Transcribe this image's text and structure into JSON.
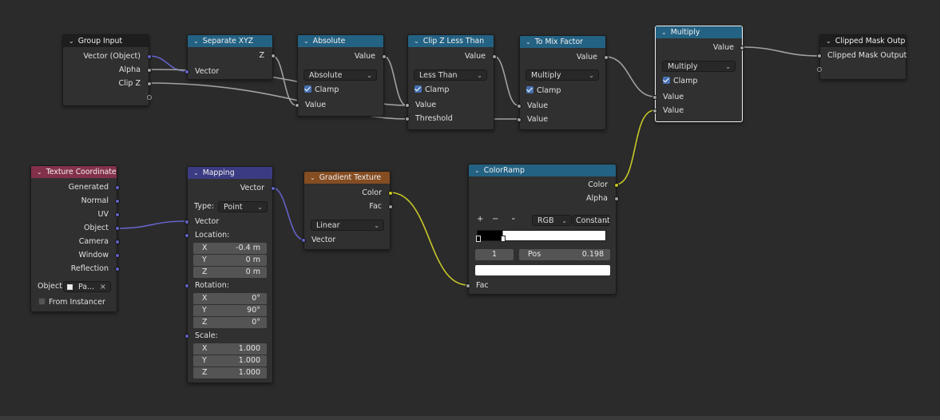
{
  "nodes": {
    "group_input": {
      "title": "Group Input",
      "outputs": [
        "Vector (Object)",
        "Alpha",
        "Clip Z"
      ]
    },
    "separate_xyz": {
      "title": "Separate XYZ",
      "output": "Z",
      "input": "Vector"
    },
    "absolute": {
      "title": "Absolute",
      "output": "Value",
      "operation": "Absolute",
      "clamp_label": "Clamp",
      "clamp": true,
      "input": "Value"
    },
    "clip_z": {
      "title": "Clip Z Less Than",
      "output": "Value",
      "operation": "Less Than",
      "clamp_label": "Clamp",
      "clamp": true,
      "inputs": [
        "Value",
        "Threshold"
      ]
    },
    "to_mix": {
      "title": "To Mix Factor",
      "output": "Value",
      "operation": "Multiply",
      "clamp_label": "Clamp",
      "clamp": true,
      "inputs": [
        "Value",
        "Value"
      ]
    },
    "multiply": {
      "title": "Multiply",
      "output": "Value",
      "operation": "Multiply",
      "clamp_label": "Clamp",
      "clamp": true,
      "inputs": [
        "Value",
        "Value"
      ]
    },
    "clipped_output": {
      "title": "Clipped Mask Output",
      "input": "Clipped Mask Output"
    },
    "texture_coordinate": {
      "title": "Texture Coordinate",
      "outputs": [
        "Generated",
        "Normal",
        "UV",
        "Object",
        "Camera",
        "Window",
        "Reflection"
      ],
      "object_label": "Object:",
      "object_value": "Pa...",
      "from_instancer_label": "From Instancer"
    },
    "mapping": {
      "title": "Mapping",
      "output": "Vector",
      "type_label": "Type:",
      "type_value": "Point",
      "vector_label": "Vector",
      "location_label": "Location:",
      "location": [
        {
          "axis": "X",
          "value": "-0.4 m"
        },
        {
          "axis": "Y",
          "value": "0 m"
        },
        {
          "axis": "Z",
          "value": "0 m"
        }
      ],
      "rotation_label": "Rotation:",
      "rotation": [
        {
          "axis": "X",
          "value": "0°"
        },
        {
          "axis": "Y",
          "value": "90°"
        },
        {
          "axis": "Z",
          "value": "0°"
        }
      ],
      "scale_label": "Scale:",
      "scale": [
        {
          "axis": "X",
          "value": "1.000"
        },
        {
          "axis": "Y",
          "value": "1.000"
        },
        {
          "axis": "Z",
          "value": "1.000"
        }
      ]
    },
    "gradient_texture": {
      "title": "Gradient Texture",
      "outputs": [
        "Color",
        "Fac"
      ],
      "type_value": "Linear",
      "input": "Vector"
    },
    "color_ramp": {
      "title": "ColorRamp",
      "outputs": [
        "Color",
        "Alpha"
      ],
      "add_btn": "+",
      "remove_btn": "−",
      "menu_btn": "⌄",
      "color_mode": "RGB",
      "interpolation": "Constant",
      "active_index": "1",
      "pos_label": "Pos",
      "pos_value": "0.198",
      "input": "Fac"
    }
  },
  "colors": {
    "background": "#2b2b2b",
    "node_body": "#303030",
    "header_converter": "#246283",
    "header_input": "#83314a",
    "header_vector": "#3b3b83",
    "header_texture": "#854d22",
    "socket_float": "#a1a1a1",
    "socket_vector": "#6363c7",
    "socket_color": "#c7c729"
  }
}
